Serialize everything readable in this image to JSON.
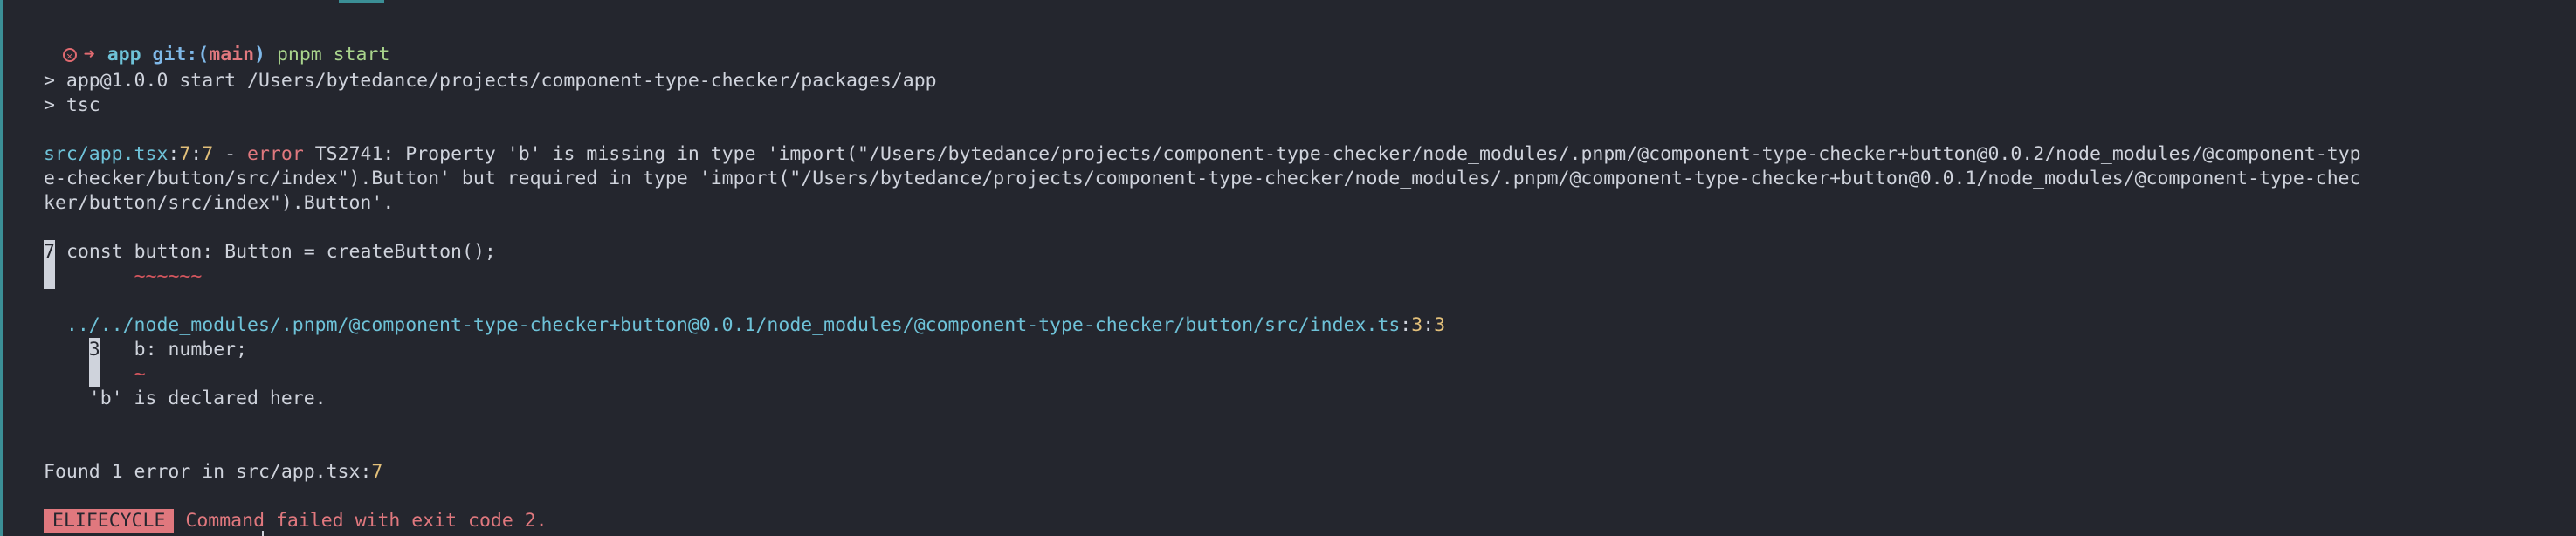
{
  "prompt": {
    "dir": "app",
    "git_label": "git:",
    "branch_open": "(",
    "branch": "main",
    "branch_close": ")",
    "command": "pnpm start"
  },
  "script_lines": [
    "> app@1.0.0 start /Users/bytedance/projects/component-type-checker/packages/app",
    "> tsc"
  ],
  "error": {
    "file": "src/app.tsx",
    "loc_sep1": ":",
    "line_no": "7",
    "loc_sep2": ":",
    "col_no": "7",
    "dash": " - ",
    "level": "error",
    "code": "TS2741",
    "msg_line1": ": Property 'b' is missing in type 'import(\"/Users/bytedance/projects/component-type-checker/node_modules/.pnpm/@component-type-checker+button@0.0.2/node_modules/@component-typ",
    "msg_line2": "e-checker/button/src/index\").Button' but required in type 'import(\"/Users/bytedance/projects/component-type-checker/node_modules/.pnpm/@component-type-checker+button@0.0.1/node_modules/@component-type-chec",
    "msg_line3": "ker/button/src/index\").Button'."
  },
  "snippet": {
    "gutter": "7",
    "code": "const button: Button = createButton();",
    "squiggle": "~~~~~~"
  },
  "related": {
    "path": "../../node_modules/.pnpm/@component-type-checker+button@0.0.1/node_modules/@component-type-checker/button/src/index.ts",
    "sep1": ":",
    "line_no": "3",
    "sep2": ":",
    "col_no": "3",
    "gutter": "3",
    "code": "b: number;",
    "squiggle": "~",
    "note": "'b' is declared here."
  },
  "summary": {
    "text": "Found 1 error in src/app.tsx",
    "sep": ":",
    "line_no": "7"
  },
  "lifecycle": {
    "badge": "ELIFECYCLE",
    "message": "Command failed with exit code 2."
  },
  "colors": {
    "background": "#24262e",
    "error": "#e0787e",
    "path": "#6ec2d8",
    "number": "#e3c07a",
    "command": "#a9d48c"
  }
}
